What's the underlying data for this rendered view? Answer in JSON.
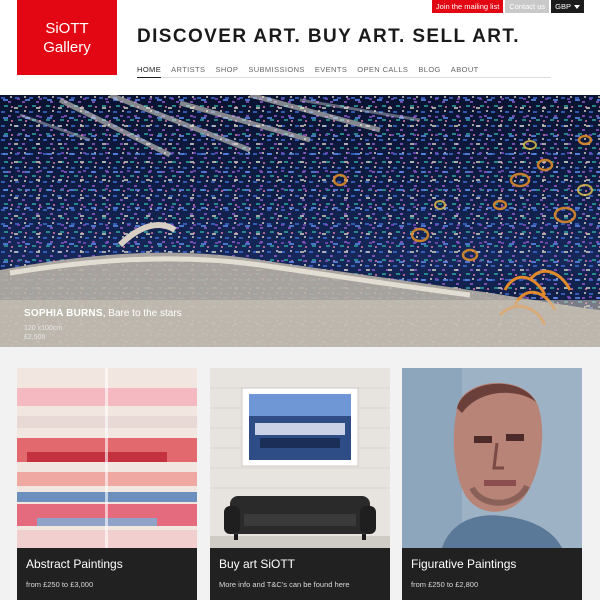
{
  "brand": {
    "line1": "SiOTT",
    "line2": "Gallery",
    "color": "#e30613"
  },
  "topbar": {
    "mailing_list": "Join the mailing list",
    "contact": "Contact us",
    "currency": "GBP"
  },
  "tagline": "DISCOVER ART. BUY ART. SELL ART.",
  "nav": [
    "HOME",
    "ARTISTS",
    "SHOP",
    "SUBMISSIONS",
    "EVENTS",
    "OPEN CALLS",
    "BLOG",
    "ABOUT"
  ],
  "nav_active": "HOME",
  "hero": {
    "artist": "SOPHIA BURNS",
    "title": "Bare to the stars",
    "size": "120 x100cm",
    "price": "£2,500"
  },
  "cards": [
    {
      "title": "Abstract Paintings",
      "subtitle": "from £250 to £3,000"
    },
    {
      "title": "Buy art SiOTT",
      "subtitle": "More info and T&C's can be found here"
    },
    {
      "title": "Figurative Paintings",
      "subtitle": "from £250 to £2,800"
    }
  ]
}
